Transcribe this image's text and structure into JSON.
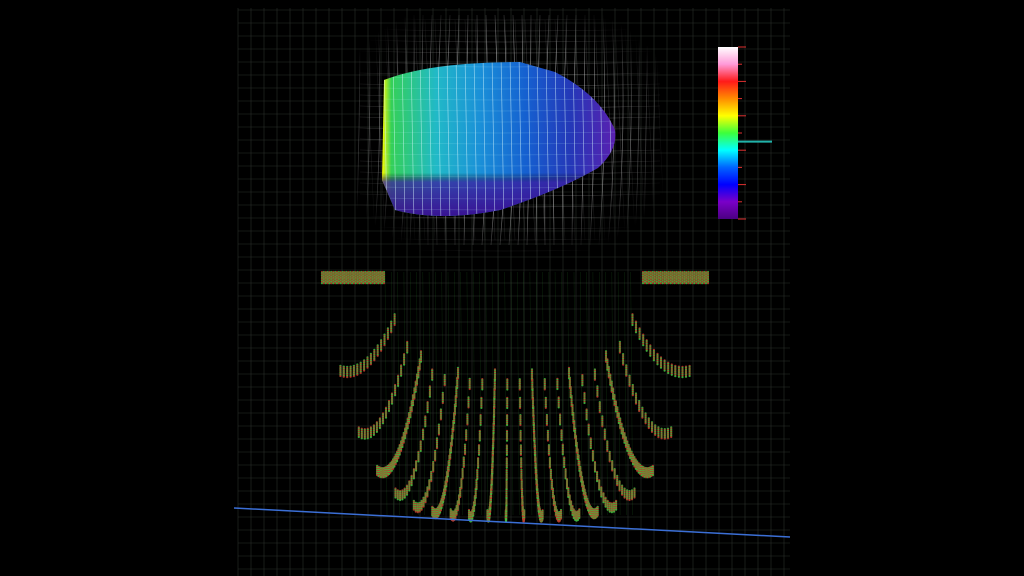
{
  "viewport": {
    "background": "#000000",
    "grid_color": "#2a2f2a",
    "grid_major_color": "#3a403a"
  },
  "colors": {
    "wireframe": "#d8d8d8",
    "point_red": "#c0392b",
    "point_green": "#3fbf3f",
    "ground_line": "#3b6fd6",
    "scale_marker": "#20b2aa",
    "scale_tick": "#e03030"
  },
  "color_scale": {
    "stops": [
      "#ffffff",
      "#ff9ad8",
      "#ff1a1a",
      "#ff8c00",
      "#ffff00",
      "#3cff3c",
      "#00ffff",
      "#0064ff",
      "#0000ff",
      "#7a00c8",
      "#4b0082"
    ],
    "marker_level": 0.55
  },
  "top_surface": {
    "gradient": [
      "#ffff00",
      "#34d058",
      "#21b9c7",
      "#1a8fd8",
      "#1560d0",
      "#2438b8",
      "#5a20b0"
    ]
  }
}
